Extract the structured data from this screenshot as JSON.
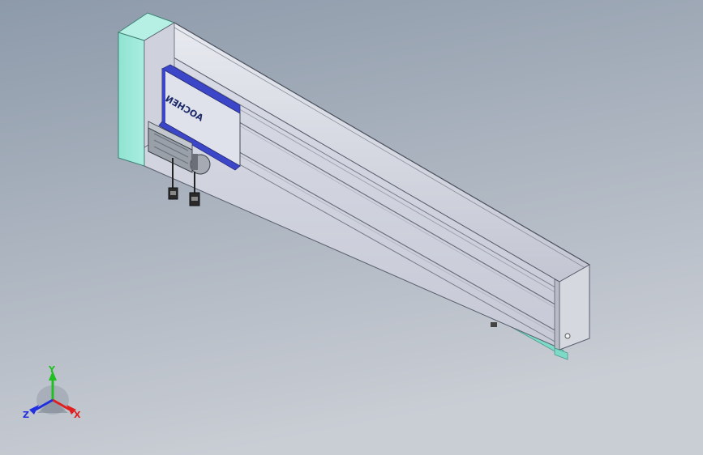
{
  "viewport": {
    "background_top": "#8d9aaa",
    "background_bottom": "#c8ccd4"
  },
  "model": {
    "carriage_logo_text": "AOCHEN",
    "colors": {
      "end_cap_teal": "#8fe3d2",
      "rail_body": "#c9ccd8",
      "rail_face": "#d7dae4",
      "carriage_plate": "#dfe2ea",
      "carriage_blue": "#3c46c8",
      "motor": "#9aa0a8",
      "base_strip": "#7fd9c7"
    }
  },
  "triad": {
    "x_label": "X",
    "y_label": "Y",
    "z_label": "Z",
    "x_color": "#e02020",
    "y_color": "#20c020",
    "z_color": "#2030e0"
  }
}
